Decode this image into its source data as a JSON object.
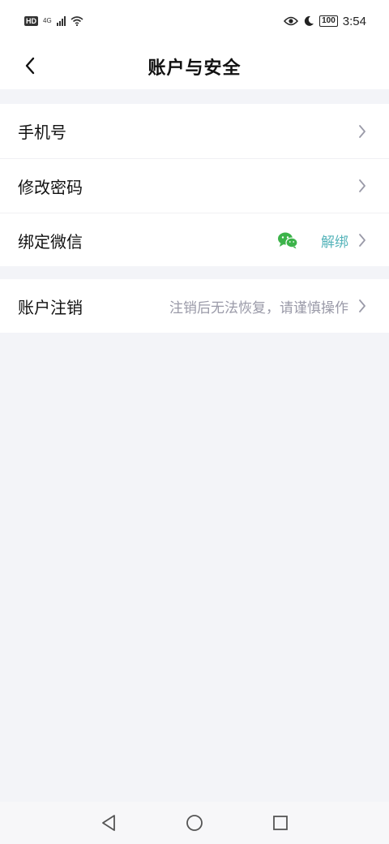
{
  "status_bar": {
    "hd": "HD",
    "network": "4G",
    "battery": "100",
    "time": "3:54",
    "icons": [
      "signal-icon",
      "wifi-icon",
      "eye-icon",
      "moon-icon",
      "battery-icon"
    ]
  },
  "header": {
    "title": "账户与安全",
    "back_icon": "chevron-left-icon"
  },
  "sections": {
    "account": {
      "phone": {
        "label": "手机号",
        "value": ""
      },
      "password": {
        "label": "修改密码"
      },
      "wechat": {
        "label": "绑定微信",
        "action": "解绑",
        "icon": "wechat-icon"
      }
    },
    "deactivate": {
      "label": "账户注销",
      "hint": "注销后无法恢复，请谨慎操作"
    }
  },
  "colors": {
    "accent_teal": "#56b4ba",
    "wechat_green": "#3cb34a",
    "hint_gray": "#9a9aa8",
    "page_background": "#f3f4f8"
  },
  "system_nav": {
    "icons": [
      "back-triangle-icon",
      "home-circle-icon",
      "recents-square-icon"
    ]
  }
}
